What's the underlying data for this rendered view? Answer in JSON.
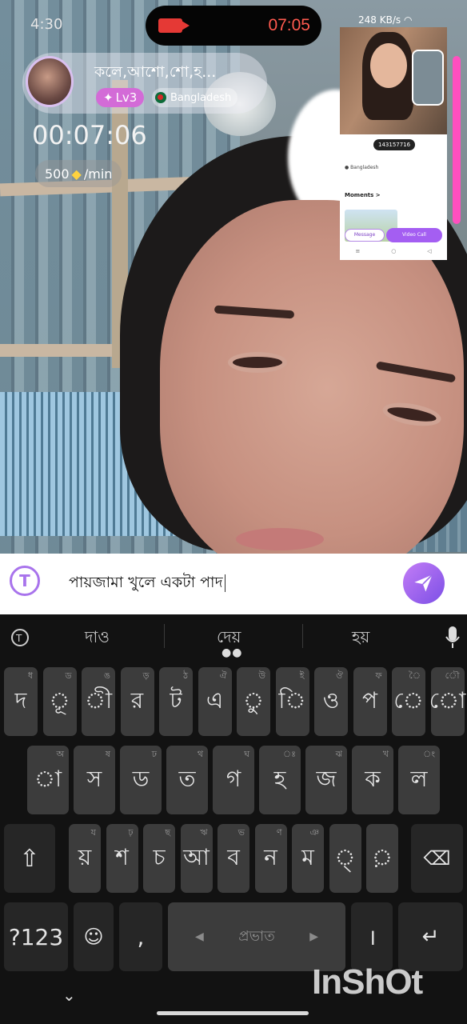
{
  "status_bar": {
    "time": "4:30",
    "net_speed": "248 KB/s"
  },
  "recording": {
    "timer": "07:05"
  },
  "caller": {
    "name": "কলে,আশো,শো,হ...",
    "level": "Lv3",
    "country": "Bangladesh",
    "call_duration": "00:07:06",
    "rate_amount": "500",
    "rate_unit": "/min"
  },
  "pip_profile": {
    "id_text": "143157716",
    "location": "Bangladesh",
    "moments_label": "Moments >",
    "message_button": "Message",
    "video_call_button": "Video Call"
  },
  "chat_input": {
    "text": "পায়জামা খুলে একটা পাদ"
  },
  "keyboard": {
    "suggestions": [
      "দাও",
      "দেয়",
      "হয়"
    ],
    "row1": [
      {
        "main": "দ",
        "hint": "ধ"
      },
      {
        "main": "ূ",
        "hint": "ড"
      },
      {
        "main": "ী",
        "hint": "ঙ"
      },
      {
        "main": "র",
        "hint": "ড়"
      },
      {
        "main": "ট",
        "hint": "ঠ"
      },
      {
        "main": "এ",
        "hint": "ঐ"
      },
      {
        "main": "ু",
        "hint": "উ"
      },
      {
        "main": "ি",
        "hint": "ই"
      },
      {
        "main": "ও",
        "hint": "ঔ"
      },
      {
        "main": "প",
        "hint": "ফ"
      },
      {
        "main": "ে",
        "hint": "ৈ"
      },
      {
        "main": "ো",
        "hint": "ৌ"
      }
    ],
    "row2": [
      {
        "main": "া",
        "hint": "অ"
      },
      {
        "main": "স",
        "hint": "ষ"
      },
      {
        "main": "ড",
        "hint": "ঢ"
      },
      {
        "main": "ত",
        "hint": "থ"
      },
      {
        "main": "গ",
        "hint": "ঘ"
      },
      {
        "main": "হ",
        "hint": "ঃ"
      },
      {
        "main": "জ",
        "hint": "ঝ"
      },
      {
        "main": "ক",
        "hint": "খ"
      },
      {
        "main": "ল",
        "hint": "ং"
      }
    ],
    "row3": [
      {
        "main": "য়",
        "hint": "য"
      },
      {
        "main": "শ",
        "hint": "ঢ়"
      },
      {
        "main": "চ",
        "hint": "ছ"
      },
      {
        "main": "আ",
        "hint": "ঋ"
      },
      {
        "main": "ব",
        "hint": "ভ"
      },
      {
        "main": "ন",
        "hint": "ণ"
      },
      {
        "main": "ম",
        "hint": "ঞ"
      },
      {
        "main": "্",
        "hint": ""
      },
      {
        "main": "়",
        "hint": ""
      }
    ],
    "symbols_key": "?123",
    "comma_key": ",",
    "space_label": "প্রভাত",
    "period_key": "।"
  },
  "watermark": "InShOt"
}
